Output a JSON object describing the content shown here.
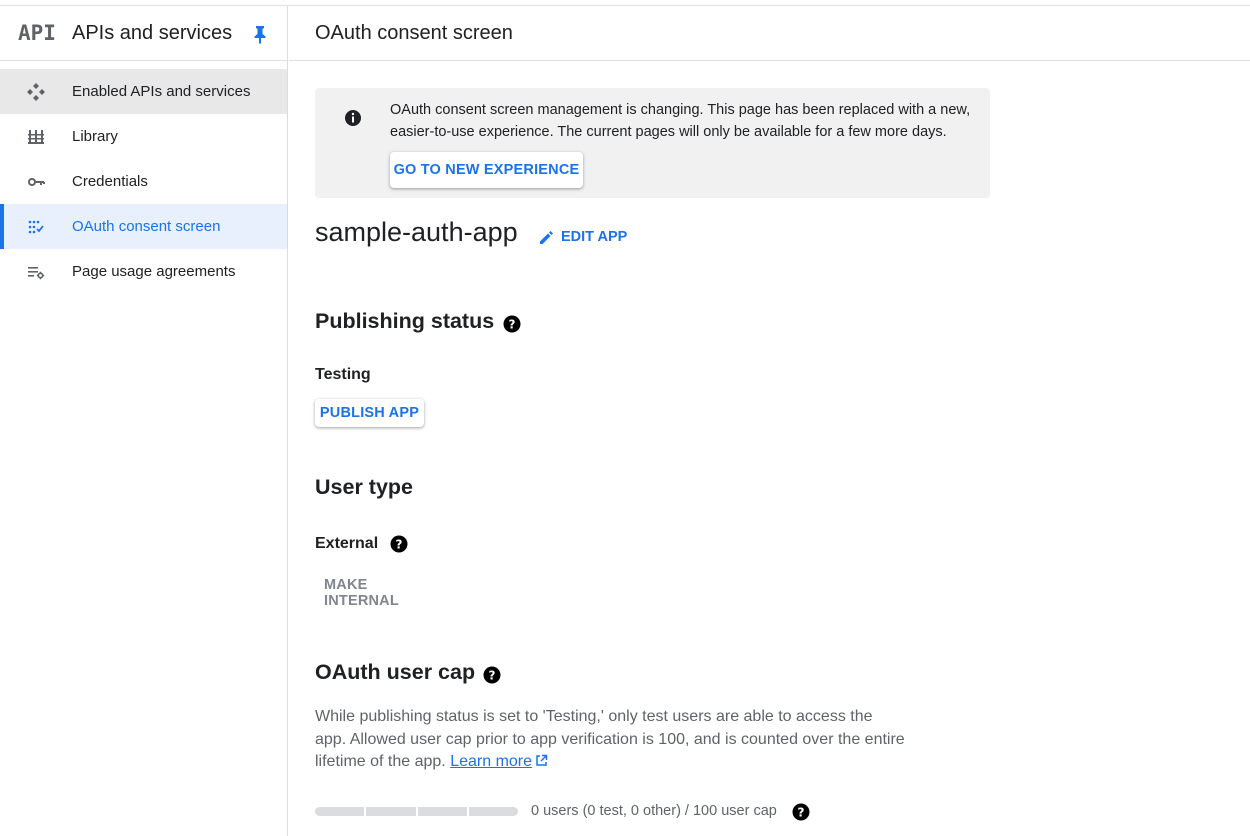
{
  "sidebar": {
    "logo_text": "API",
    "title": "APIs and services",
    "items": [
      {
        "label": "Enabled APIs and services",
        "icon": "apis-diamond-icon"
      },
      {
        "label": "Library",
        "icon": "library-icon"
      },
      {
        "label": "Credentials",
        "icon": "key-icon"
      },
      {
        "label": "OAuth consent screen",
        "icon": "consent-dots-icon"
      },
      {
        "label": "Page usage agreements",
        "icon": "settings-list-icon"
      }
    ]
  },
  "header": {
    "title": "OAuth consent screen"
  },
  "banner": {
    "text": "OAuth consent screen management is changing. This page has been replaced with a new, easier-to-use experience. The current pages will only be available for a few more days.",
    "button": "GO TO NEW EXPERIENCE"
  },
  "app": {
    "name": "sample-auth-app",
    "edit_label": "EDIT APP"
  },
  "publishing": {
    "title": "Publishing status",
    "status": "Testing",
    "button": "PUBLISH APP"
  },
  "user_type": {
    "title": "User type",
    "value": "External",
    "button": "MAKE INTERNAL"
  },
  "user_cap": {
    "title": "OAuth user cap",
    "description": "While publishing status is set to 'Testing,' only test users are able to access the app. Allowed user cap prior to app verification is 100, and is counted over the entire lifetime of the app.",
    "learn_more": "Learn more",
    "usage_text": "0 users (0 test, 0 other) / 100 user cap",
    "usage_fraction": 0
  },
  "colors": {
    "accent": "#1a73e8",
    "text": "#202124",
    "muted": "#5f6368"
  }
}
